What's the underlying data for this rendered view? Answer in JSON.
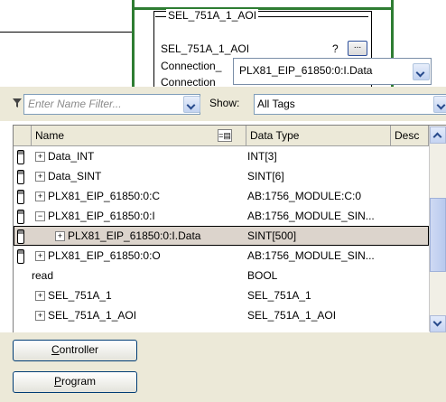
{
  "aoi_block": {
    "title": "SEL_751A_1_AOI",
    "instance_label": "SEL_751A_1_AOI",
    "question_mark": "?",
    "browse_button": "...",
    "row2_label": "Connection_",
    "row3_label": "Connection",
    "edit_value": "PLX81_EIP_61850:0:I.Data"
  },
  "filter": {
    "placeholder": "Enter Name Filter...",
    "show_label": "Show:",
    "show_value": "All Tags"
  },
  "table": {
    "columns": [
      "Name",
      "Data Type",
      "Desc"
    ],
    "rows": [
      {
        "name": "Data_INT",
        "type": "INT[3]",
        "expander": "+",
        "indent": 0,
        "icon": true,
        "selected": false
      },
      {
        "name": "Data_SINT",
        "type": "SINT[6]",
        "expander": "+",
        "indent": 0,
        "icon": true,
        "selected": false
      },
      {
        "name": "PLX81_EIP_61850:0:C",
        "type": "AB:1756_MODULE:C:0",
        "expander": "+",
        "indent": 0,
        "icon": true,
        "selected": false
      },
      {
        "name": "PLX81_EIP_61850:0:I",
        "type": "AB:1756_MODULE_SIN...",
        "expander": "−",
        "indent": 0,
        "icon": true,
        "selected": false
      },
      {
        "name": "PLX81_EIP_61850:0:I.Data",
        "type": "SINT[500]",
        "expander": "+",
        "indent": 1,
        "icon": true,
        "selected": true
      },
      {
        "name": "PLX81_EIP_61850:0:O",
        "type": "AB:1756_MODULE_SIN...",
        "expander": "+",
        "indent": 0,
        "icon": true,
        "selected": false
      },
      {
        "name": "read",
        "type": "BOOL",
        "expander": "",
        "indent": 0,
        "icon": false,
        "selected": false
      },
      {
        "name": "SEL_751A_1",
        "type": "SEL_751A_1",
        "expander": "+",
        "indent": 0,
        "icon": false,
        "selected": false
      },
      {
        "name": "SEL_751A_1_AOI",
        "type": "SEL_751A_1_AOI",
        "expander": "+",
        "indent": 0,
        "icon": false,
        "selected": false
      }
    ]
  },
  "buttons": {
    "controller": "Controller",
    "program": "Program"
  }
}
